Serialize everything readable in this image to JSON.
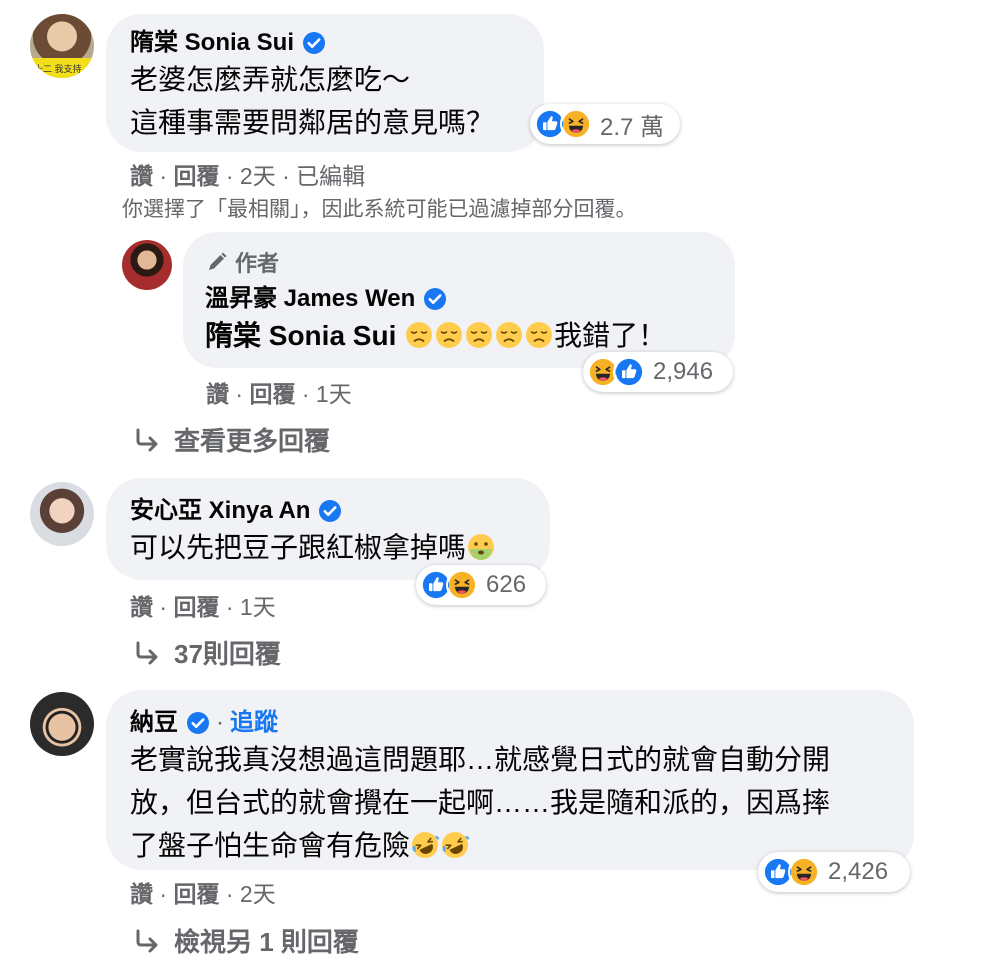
{
  "comments": [
    {
      "author": "隋棠 Sonia Sui",
      "lines": [
        "老婆怎麼弄就怎麼吃～",
        "這種事需要問鄰居的意見嗎？"
      ],
      "reaction_count": "2.7 萬",
      "like_label": "讚",
      "reply_label": "回覆",
      "time": "2天",
      "edited": "已編輯",
      "avatar_text": "十二 我支持"
    },
    {
      "author": "安心亞 Xinya An",
      "text": "可以先把豆子跟紅椒拿掉嗎",
      "reaction_count": "626",
      "like_label": "讚",
      "reply_label": "回覆",
      "time": "1天",
      "more_replies": "37則回覆"
    },
    {
      "author": "納豆",
      "follow_label": "追蹤",
      "lines": [
        "老實說我真沒想過這問題耶…就感覺日式的就會自動分開",
        "放，但台式的就會攪在一起啊……我是隨和派的，因爲摔",
        "了盤子怕生命會有危險"
      ],
      "reaction_count": "2,426",
      "like_label": "讚",
      "reply_label": "回覆",
      "time": "2天",
      "more_replies": "檢視另 1 則回覆"
    }
  ],
  "filter_note": "你選擇了「最相關」，因此系統可能已過濾掉部分回覆。",
  "reply": {
    "badge": "作者",
    "author": "溫昇豪 James Wen",
    "mention": "隋棠 Sonia Sui",
    "suffix": "我錯了！",
    "reaction_count": "2,946",
    "like_label": "讚",
    "reply_label": "回覆",
    "time": "1天"
  },
  "view_more_replies": "查看更多回覆",
  "separator": " · ",
  "colors": {
    "bubble": "#f0f2f5",
    "verified": "#1877f2",
    "meta": "#65676b",
    "like": "#1877f2",
    "haha": "#f7b125"
  }
}
